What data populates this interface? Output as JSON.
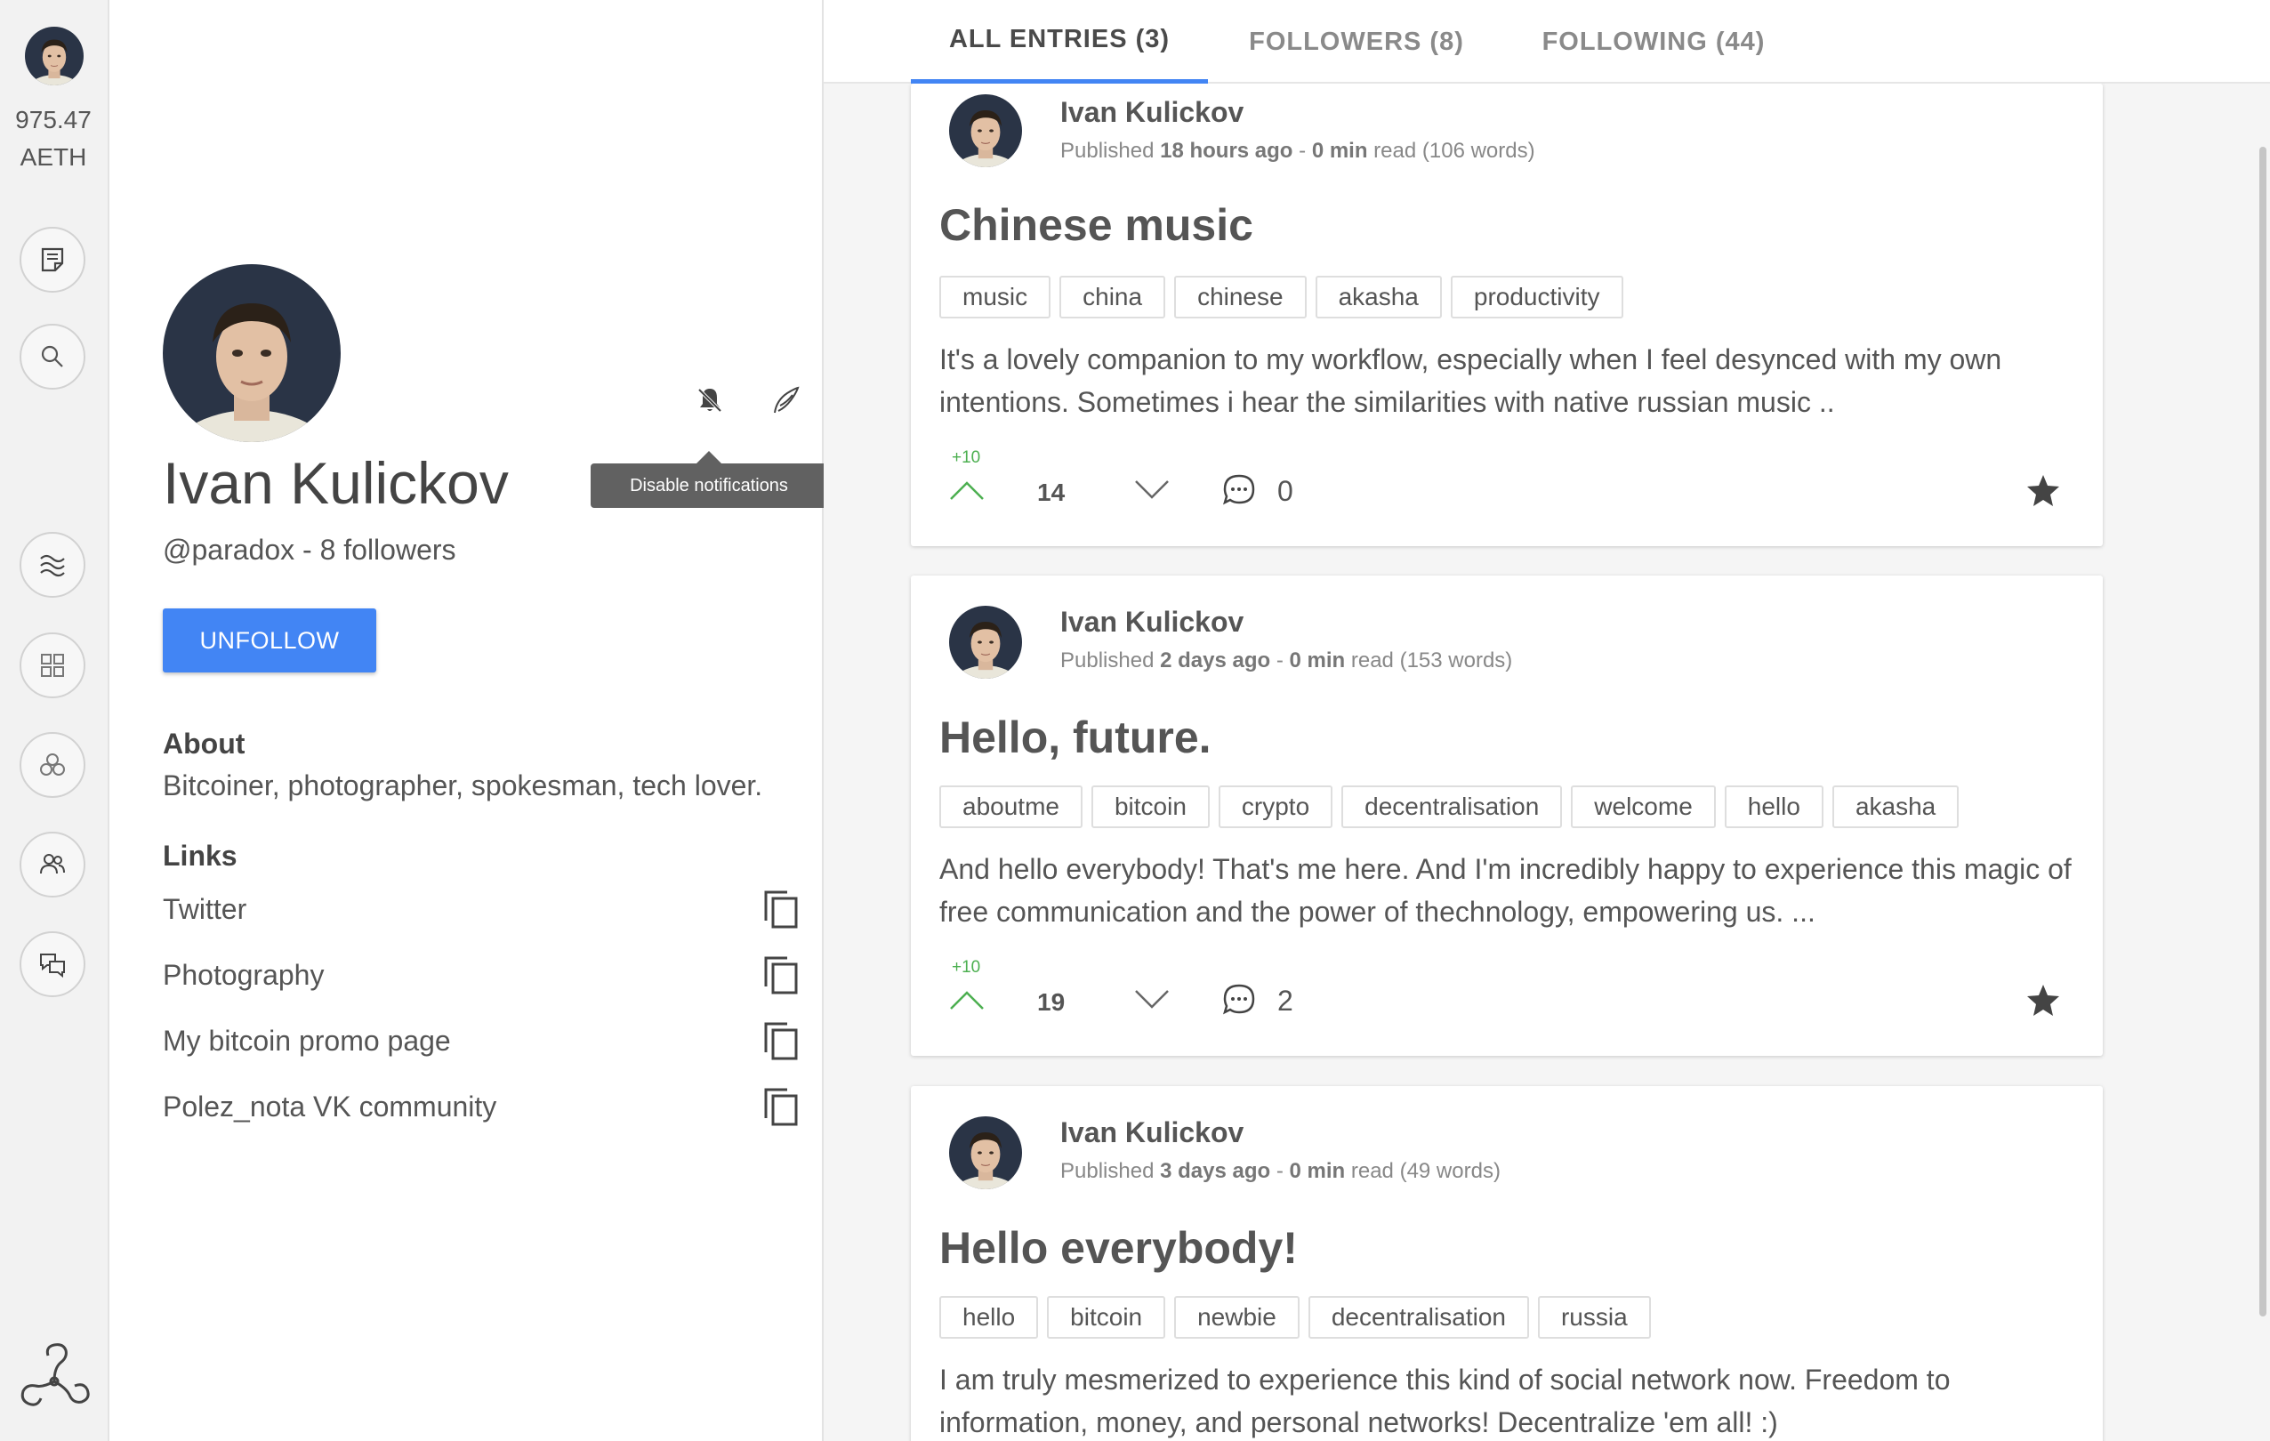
{
  "rail": {
    "balance_value": "975.47",
    "balance_unit": "AETH",
    "icons": [
      "new-entry-icon",
      "search-icon",
      "stream-icon",
      "dashboard-icon",
      "communities-icon",
      "people-icon",
      "chat-icon",
      "akasha-logo-icon"
    ]
  },
  "profile": {
    "name": "Ivan Kulickov",
    "subtitle": "@paradox - 8 followers",
    "unfollow_label": "UNFOLLOW",
    "tooltip": "Disable notifications",
    "about_heading": "About",
    "about_text": "Bitcoiner, photographer, spokesman, tech lover.",
    "links_heading": "Links",
    "links": [
      {
        "label": "Twitter"
      },
      {
        "label": "Photography"
      },
      {
        "label": "My bitcoin promo page"
      },
      {
        "label": "Polez_nota VK community"
      }
    ]
  },
  "tabs": [
    {
      "label": "ALL ENTRIES (3)",
      "active": true
    },
    {
      "label": "FOLLOWERS (8)",
      "active": false
    },
    {
      "label": "FOLLOWING (44)",
      "active": false
    }
  ],
  "entries": [
    {
      "author": "Ivan Kulickov",
      "published_label": "Published",
      "published": "18 hours ago",
      "sep": "-",
      "read_time": "0 min",
      "read_label": "read",
      "words": "(106 words)",
      "title": "Chinese music",
      "tags": [
        "music",
        "china",
        "chinese",
        "akasha",
        "productivity"
      ],
      "excerpt": "It's a lovely companion to my workflow, especially when I feel desynced with my own intentions. Sometimes i hear the similarities with native russian music ..",
      "vote_bonus": "+10",
      "score": "14",
      "comments": "0"
    },
    {
      "author": "Ivan Kulickov",
      "published_label": "Published",
      "published": "2 days ago",
      "sep": "-",
      "read_time": "0 min",
      "read_label": "read",
      "words": "(153 words)",
      "title": "Hello, future.",
      "tags": [
        "aboutme",
        "bitcoin",
        "crypto",
        "decentralisation",
        "welcome",
        "hello",
        "akasha"
      ],
      "excerpt": "And hello everybody! That's me here. And I'm incredibly happy to experience this magic of free communication and the power of thechnology, empowering us. ...",
      "vote_bonus": "+10",
      "score": "19",
      "comments": "2"
    },
    {
      "author": "Ivan Kulickov",
      "published_label": "Published",
      "published": "3 days ago",
      "sep": "-",
      "read_time": "0 min",
      "read_label": "read",
      "words": "(49 words)",
      "title": "Hello everybody!",
      "tags": [
        "hello",
        "bitcoin",
        "newbie",
        "decentralisation",
        "russia"
      ],
      "excerpt": "I am truly mesmerized to experience this kind of social network now. Freedom to information, money, and personal networks! Decentralize 'em all! :)"
    }
  ],
  "colors": {
    "accent": "#4285f4",
    "bonus": "#4caf50",
    "tooltip": "#616161"
  }
}
